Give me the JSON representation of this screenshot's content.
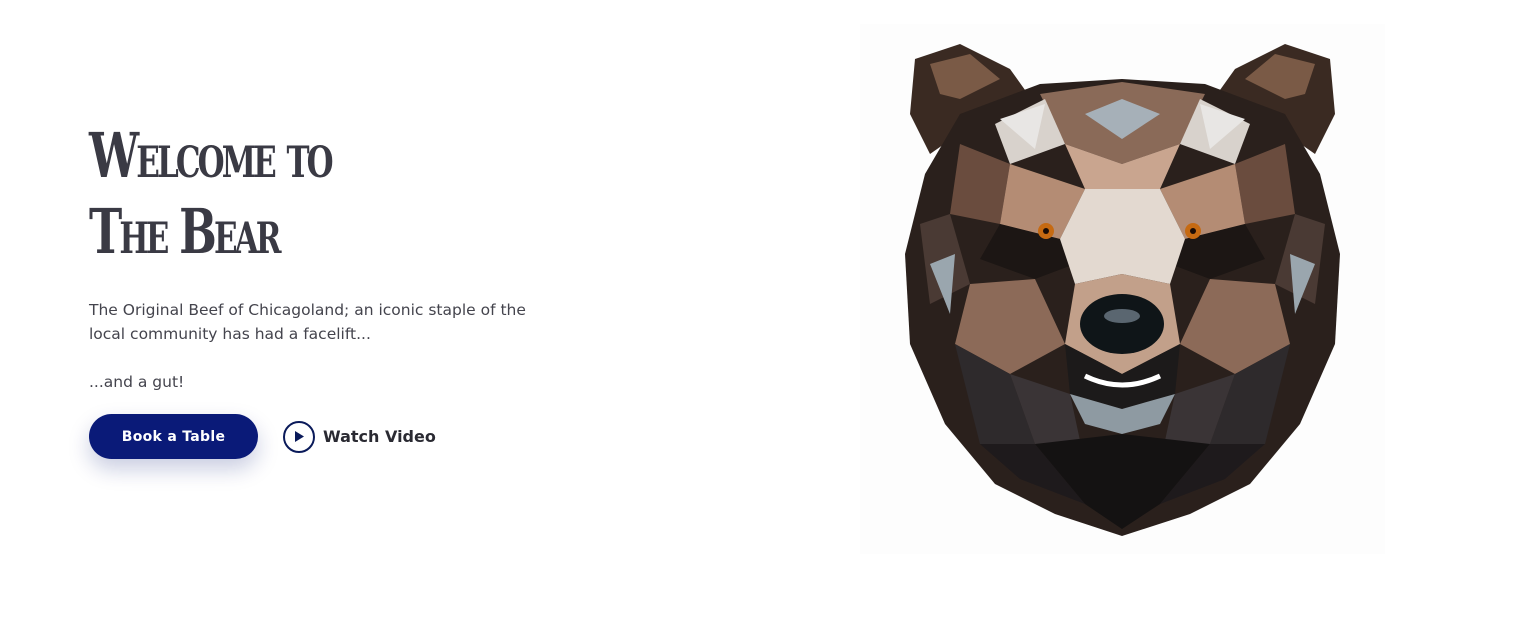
{
  "hero": {
    "title_line1": "Welcome to",
    "title_line2": "The Bear",
    "description": "The Original Beef of Chicagoland; an iconic staple of the local community has had a facelift...",
    "description2": "...and a gut!",
    "book_button_label": "Book a Table",
    "watch_video_label": "Watch Video",
    "play_icon": "play-icon",
    "bear_image_icon": "bear-head-illustration"
  },
  "colors": {
    "accent": "#0a1a78",
    "text": "#3a3a44",
    "background": "#ffffff"
  }
}
